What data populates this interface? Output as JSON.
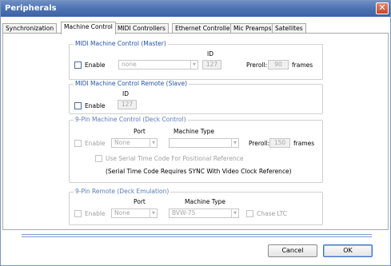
{
  "window": {
    "title": "Peripherals",
    "close_icon": "close-icon"
  },
  "tabs": [
    {
      "label": "Synchronization",
      "active": false
    },
    {
      "label": "Machine Control",
      "active": true
    },
    {
      "label": "MIDI Controllers",
      "active": false
    },
    {
      "label": "Ethernet Controllers",
      "active": false
    },
    {
      "label": "Mic Preamps",
      "active": false
    },
    {
      "label": "Satellites",
      "active": false
    }
  ],
  "mmc_master": {
    "title": "MIDI Machine Control (Master)",
    "enable_label": "Enable",
    "enable_checked": false,
    "device_value": "none",
    "id_label": "ID",
    "id_value": "127",
    "preroll_label": "Preroll:",
    "preroll_value": "90",
    "frames_label": "frames"
  },
  "mmc_slave": {
    "title": "MIDI Machine Control Remote (Slave)",
    "enable_label": "Enable",
    "enable_checked": false,
    "id_label": "ID",
    "id_value": "127"
  },
  "nine_pin_control": {
    "title": "9-Pin Machine Control (Deck Control)",
    "enable_label": "Enable",
    "port_label": "Port",
    "port_value": "None",
    "machine_type_label": "Machine Type",
    "machine_type_value": "",
    "preroll_label": "Preroll:",
    "preroll_value": "150",
    "frames_label": "frames",
    "serial_tc_label": "Use Serial Time Code For Positional Reference",
    "serial_tc_note": "(Serial Time Code Requires SYNC With Video Clock Reference)"
  },
  "nine_pin_remote": {
    "title": "9-Pin Remote (Deck Emulation)",
    "enable_label": "Enable",
    "port_label": "Port",
    "port_value": "None",
    "machine_type_label": "Machine Type",
    "machine_type_value": "BVW-75",
    "chase_label": "Chase LTC"
  },
  "buttons": {
    "cancel": "Cancel",
    "ok": "OK"
  },
  "colors": {
    "title_bar": "#4f74b3",
    "group_title": "#2753a5",
    "separator": "#7c9ccc"
  }
}
